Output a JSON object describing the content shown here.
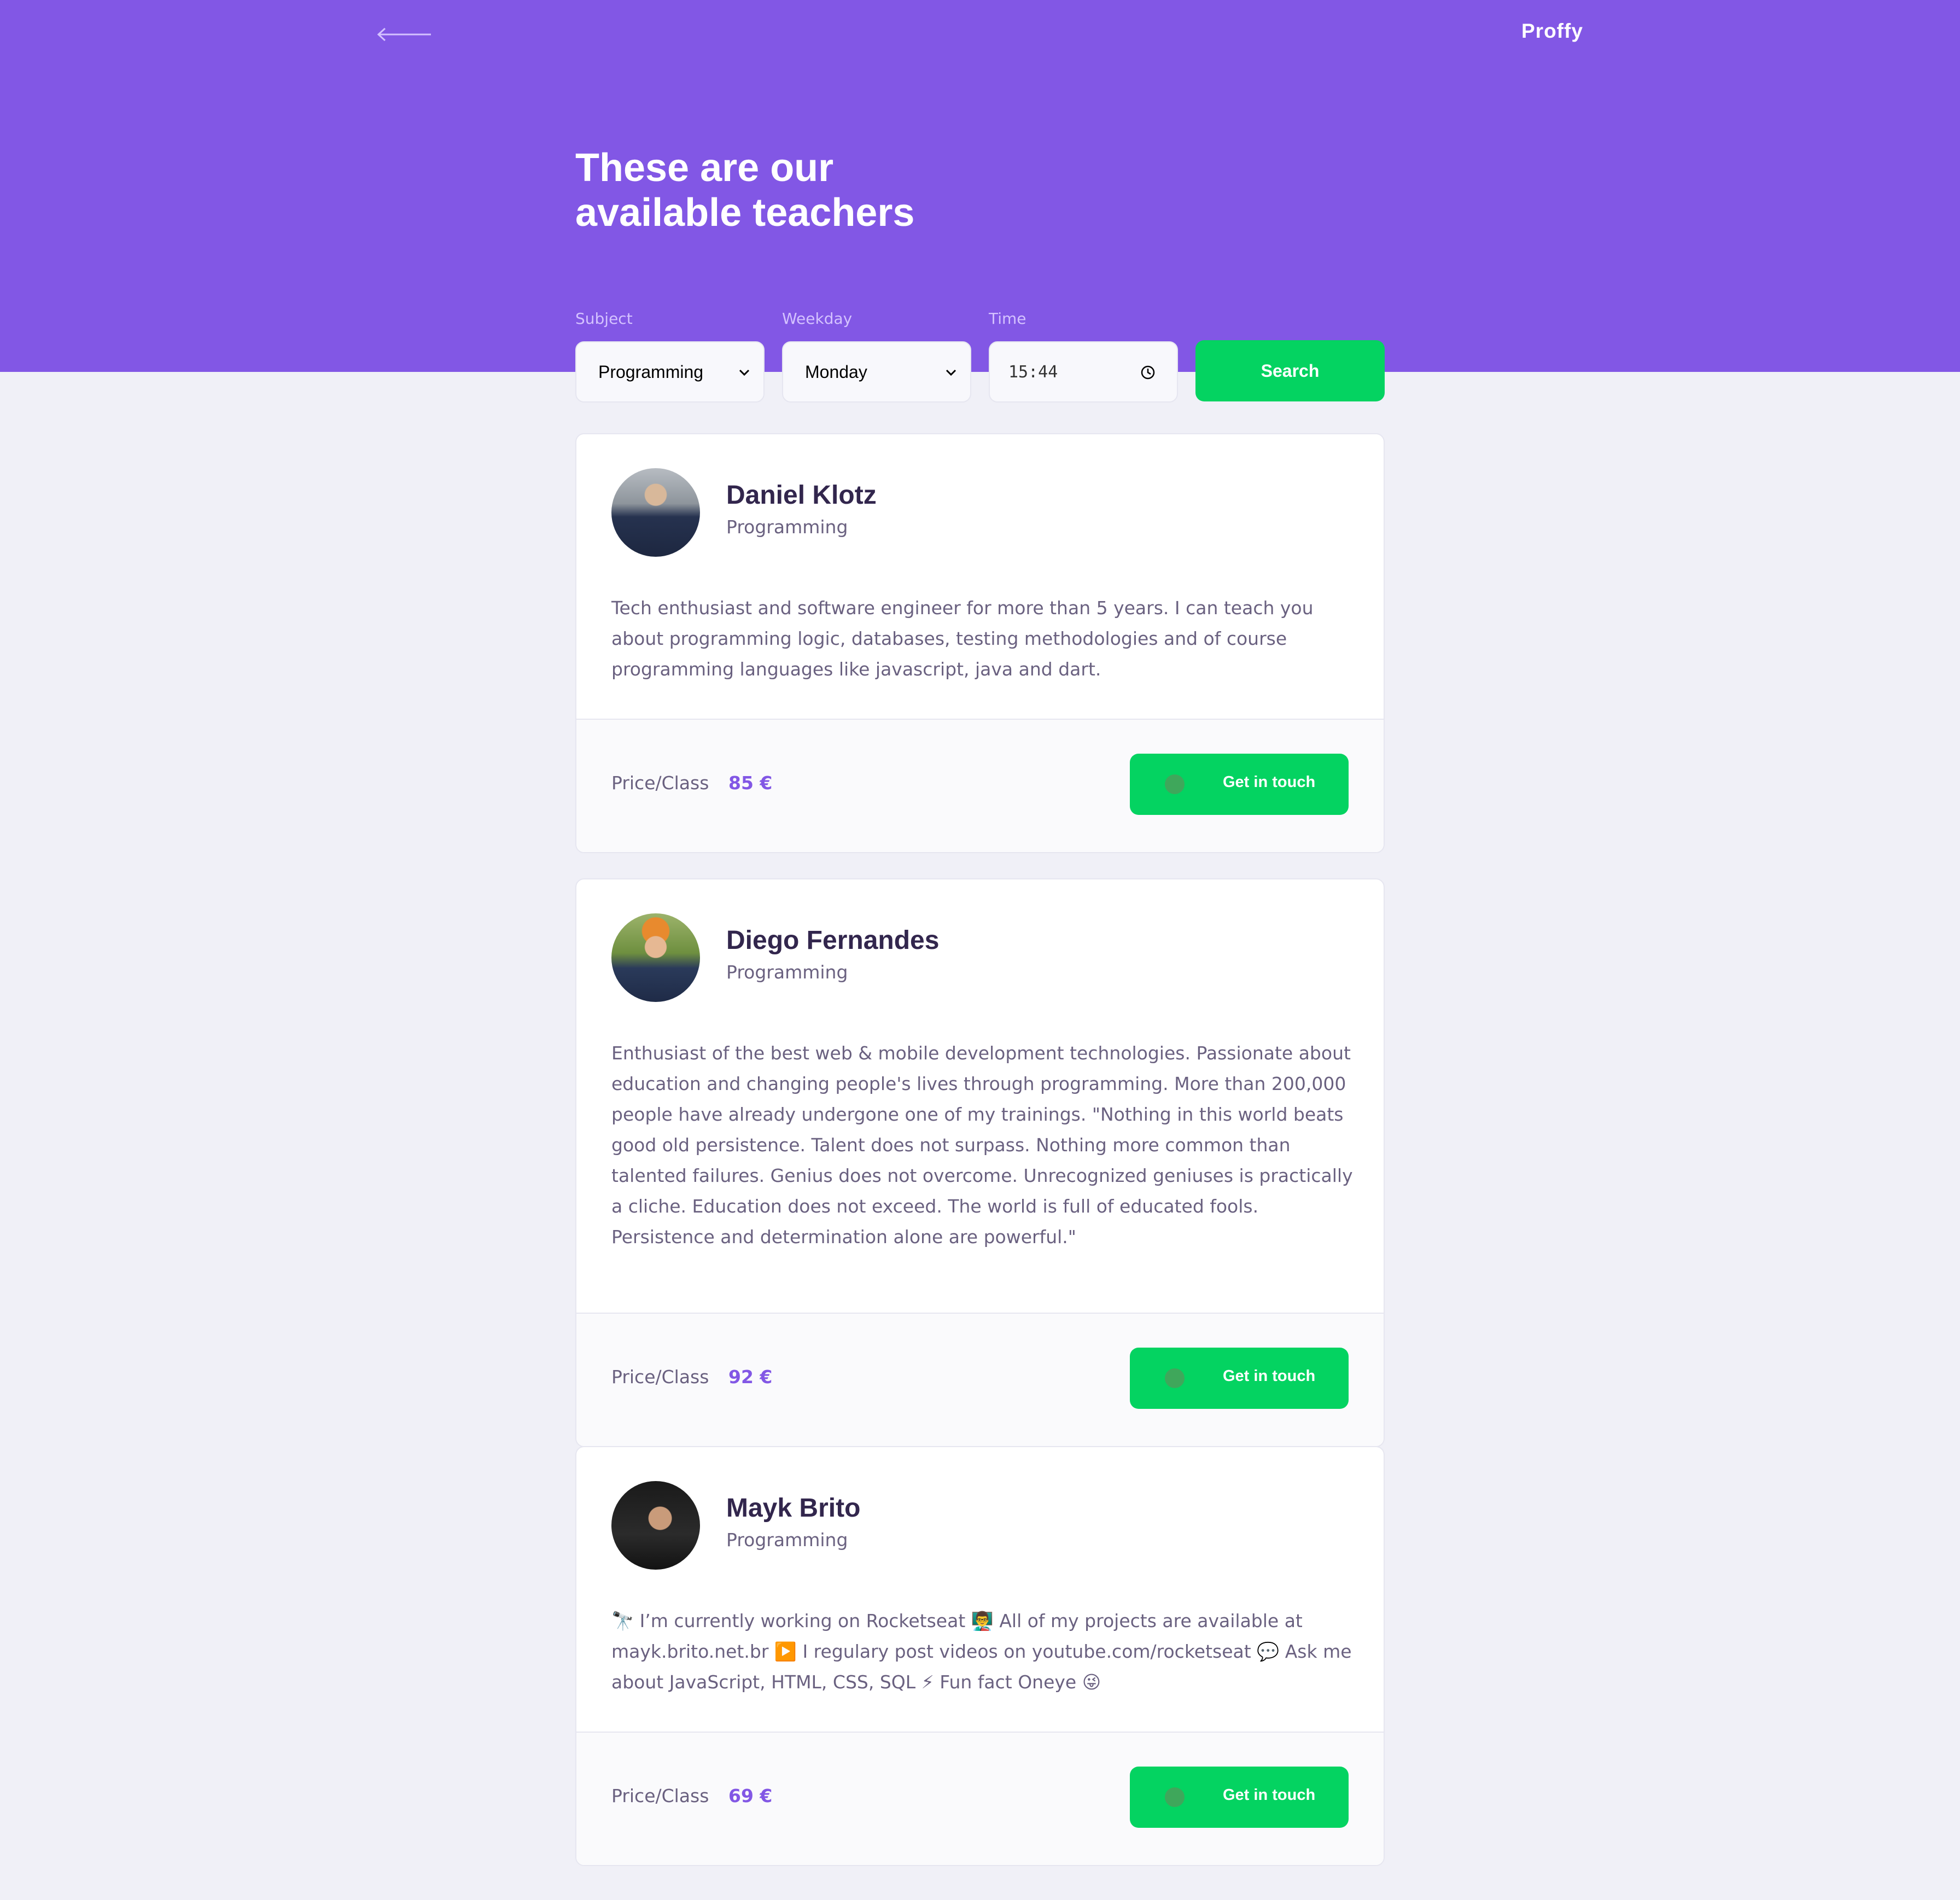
{
  "header": {
    "back_icon": "arrow-left-icon",
    "logo": "Proffy",
    "title_line1": "These are our",
    "title_line2": "available teachers"
  },
  "filters": {
    "subject": {
      "label": "Subject",
      "value": "Programming"
    },
    "weekday": {
      "label": "Weekday",
      "value": "Monday"
    },
    "time": {
      "label": "Time",
      "value": "15:44"
    },
    "search_label": "Search"
  },
  "colors": {
    "primary": "#8257e5",
    "success": "#04d361",
    "background": "#f0f0f7",
    "title_text": "#32264d",
    "body_text": "#6a6180"
  },
  "teachers": [
    {
      "name": "Daniel Klotz",
      "subject": "Programming",
      "bio": "Tech enthusiast and software engineer for more than 5 years. I can teach you about programming logic, databases, testing methodologies and of course programming languages like javascript, java and dart.",
      "price_label": "Price/Class",
      "price": "85 €",
      "contact_label": "Get in touch"
    },
    {
      "name": "Diego Fernandes",
      "subject": "Programming",
      "bio": "Enthusiast of the best web & mobile development technologies. Passionate about education and changing people's lives through programming. More than 200,000 people have already undergone one of my trainings. \"Nothing in this world beats good old persistence. Talent does not surpass. Nothing more common than talented failures. Genius does not overcome. Unrecognized geniuses is practically a cliche. Education does not exceed. The world is full of educated fools. Persistence and determination alone are powerful.\"",
      "price_label": "Price/Class",
      "price": "92 €",
      "contact_label": "Get in touch"
    },
    {
      "name": "Mayk Brito",
      "subject": "Programming",
      "bio": "🔭 I’m currently working on Rocketseat 👨‍🏫 All of my projects are available at mayk.brito.net.br ▶️ I regulary post videos on youtube.com/rocketseat 💬 Ask me about JavaScript, HTML, CSS, SQL ⚡ Fun fact Oneye 😜",
      "price_label": "Price/Class",
      "price": "69 €",
      "contact_label": "Get in touch"
    }
  ]
}
